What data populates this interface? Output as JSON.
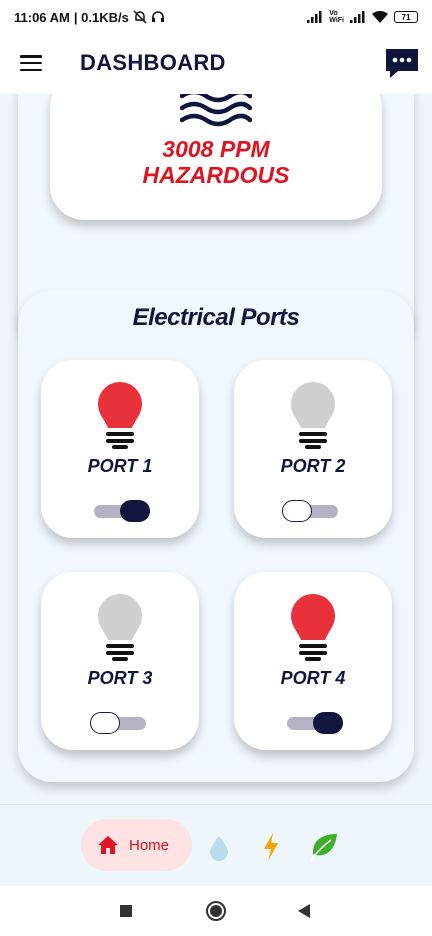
{
  "status_bar": {
    "time": "11:06 AM",
    "speed": "| 0.1KB/s",
    "volte": "Vo\nWiFi",
    "battery": "71"
  },
  "app_bar": {
    "title": "DASHBOARD"
  },
  "air_quality": {
    "value": "3008 PPM",
    "status": "HAZARDOUS",
    "status_color": "#e0141e"
  },
  "ports_section": {
    "title": "Electrical Ports",
    "ports": [
      {
        "label": "PORT 1",
        "state": "on"
      },
      {
        "label": "PORT 2",
        "state": "off"
      },
      {
        "label": "PORT 3",
        "state": "off"
      },
      {
        "label": "PORT 4",
        "state": "on"
      }
    ],
    "on_color": "#e8313a",
    "off_color": "#cfcfcf"
  },
  "bottom_nav": {
    "home_label": "Home",
    "items": [
      "home-icon",
      "water-drop-icon",
      "lightning-icon",
      "leaf-icon"
    ]
  },
  "colors": {
    "brand_dark": "#10153d",
    "accent_red": "#e0141e"
  }
}
